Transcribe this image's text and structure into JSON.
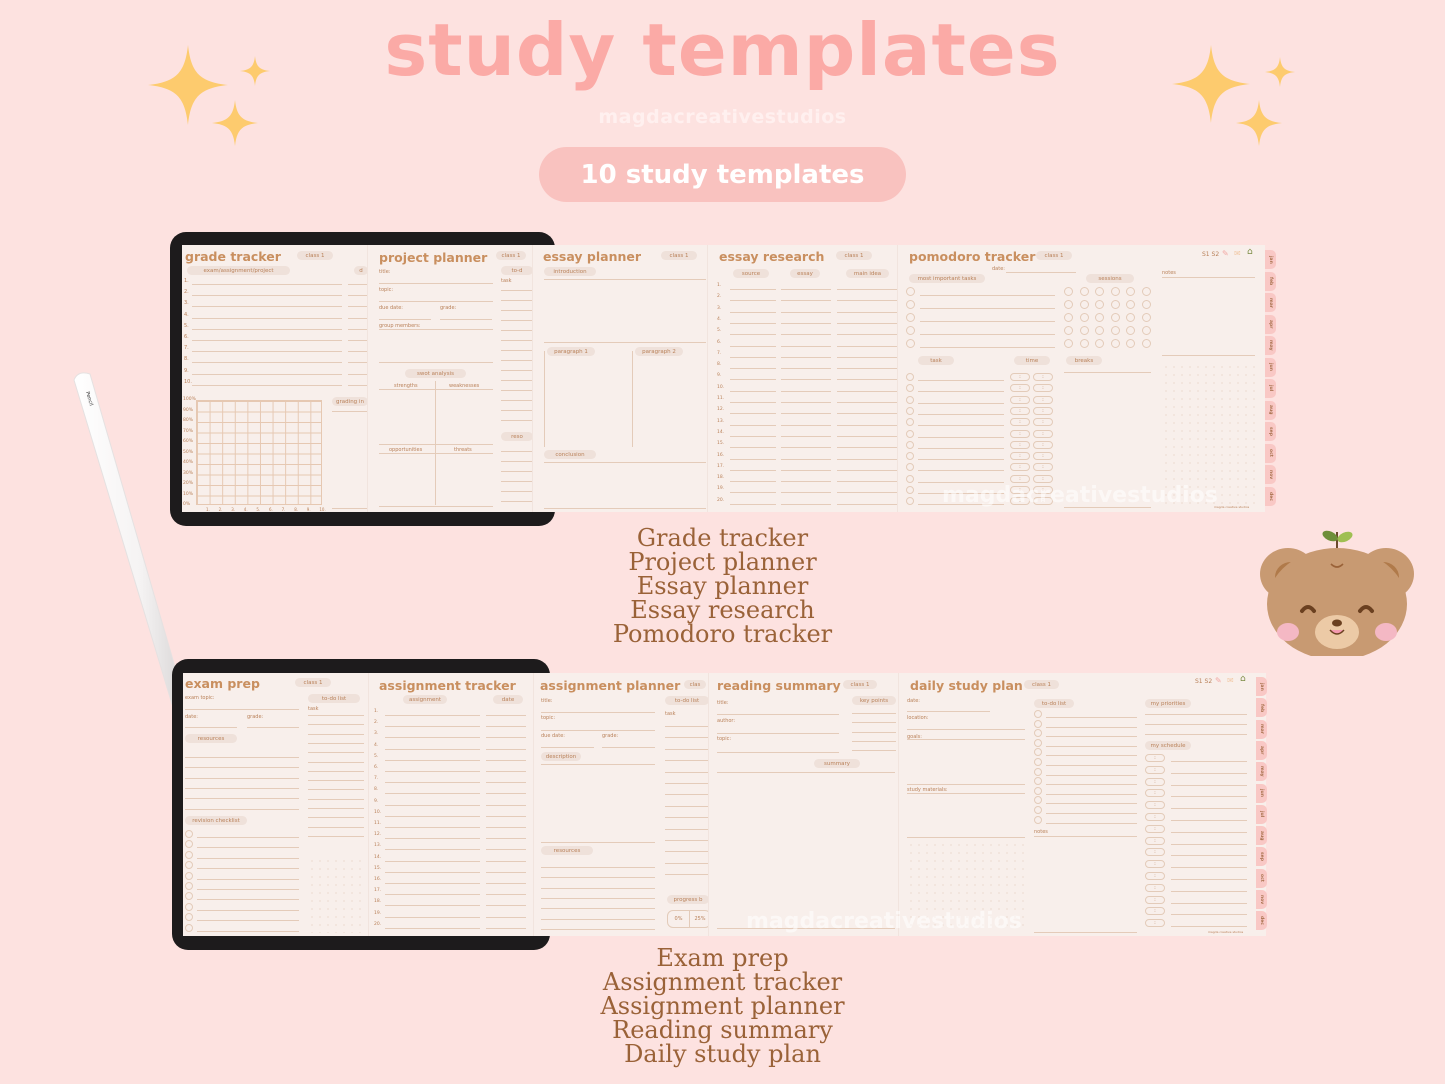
{
  "header": {
    "title": "study templates",
    "brand": "magdacreativestudios",
    "count_pill": "10 study templates"
  },
  "colors": {
    "background": "#fde2e0",
    "title": "#fbaaa6",
    "pill": "#f9c2bf",
    "sparkle": "#fdcb6e",
    "template_text": "#c98f5f",
    "caption": "#9a6238"
  },
  "icons": {
    "sparkles": "sparkle-icon",
    "pencil": "apple-pencil",
    "bear": "bear-mascot",
    "planner_pencil": "pencil-icon",
    "planner_envelope": "envelope-icon",
    "planner_home": "home-icon"
  },
  "pencil_label": "Pencil",
  "top_row": {
    "captions": [
      "Grade tracker",
      "Project planner",
      "Essay planner",
      "Essay research",
      "Pomodoro tracker"
    ],
    "grade_tracker": {
      "title": "grade tracker",
      "class_tag": "class 1",
      "col_header": "exam/assignment/project",
      "col2_header": "d",
      "rows": [
        "1.",
        "2.",
        "3.",
        "4.",
        "5.",
        "6.",
        "7.",
        "8.",
        "9.",
        "10."
      ],
      "chart_y_labels": [
        "100%",
        "90%",
        "80%",
        "70%",
        "60%",
        "50%",
        "40%",
        "30%",
        "20%",
        "10%",
        "0%"
      ],
      "chart_x_labels": [
        "1.",
        "2.",
        "3.",
        "4.",
        "5.",
        "6.",
        "7.",
        "8.",
        "9.",
        "10."
      ],
      "side_tag": "grading in"
    },
    "project_planner": {
      "title": "project planner",
      "class_tag": "class 1",
      "fields": [
        "title:",
        "topic:",
        "due date:",
        "grade:",
        "group members:"
      ],
      "todo_tag": "to-d",
      "todo_task": "task",
      "swot_tag": "swot analysis",
      "swot": [
        "strengths",
        "weaknesses",
        "opportunities",
        "threats"
      ],
      "resources_tag": "reso"
    },
    "essay_planner": {
      "title": "essay planner",
      "class_tag": "class 1",
      "sections": [
        "introduction",
        "paragraph 1",
        "paragraph 2",
        "conclusion"
      ]
    },
    "essay_research": {
      "title": "essay research",
      "class_tag": "class 1",
      "columns": [
        "source",
        "essay",
        "main idea"
      ],
      "rows": [
        "1.",
        "2.",
        "3.",
        "4.",
        "5.",
        "6.",
        "7.",
        "8.",
        "9.",
        "10.",
        "11.",
        "12.",
        "13.",
        "14.",
        "15.",
        "16.",
        "17.",
        "18.",
        "19.",
        "20."
      ]
    },
    "pomodoro_tracker": {
      "title": "pomodoro tracker",
      "class_tag": "class 1",
      "date_label": "date:",
      "mit_tag": "most important tasks",
      "sessions_tag": "sessions",
      "notes_label": "notes",
      "task_tag": "task",
      "time_tag": "time",
      "breaks_tag": "breaks",
      "time_placeholder": ":",
      "semester": "S1 S2",
      "footer": "magda creative studios"
    },
    "months": [
      "jan",
      "feb",
      "mar",
      "apr",
      "may",
      "jun",
      "jul",
      "aug",
      "sep",
      "oct",
      "nov",
      "dec"
    ],
    "watermark": "magdacreativestudios"
  },
  "bottom_row": {
    "captions": [
      "Exam prep",
      "Assignment tracker",
      "Assignment planner",
      "Reading summary",
      "Daily study plan"
    ],
    "exam_prep": {
      "title": "exam prep",
      "class_tag": "class 1",
      "fields": [
        "exam topic:",
        "date:",
        "grade:"
      ],
      "resources_tag": "resources",
      "revision_tag": "revision checklist",
      "todo_tag": "to-do list",
      "todo_task": "task"
    },
    "assignment_tracker": {
      "title": "assignment tracker",
      "columns": [
        "assignment",
        "date"
      ],
      "rows": [
        "1.",
        "2.",
        "3.",
        "4.",
        "5.",
        "6.",
        "7.",
        "8.",
        "9.",
        "10.",
        "11.",
        "12.",
        "13.",
        "14.",
        "15.",
        "16.",
        "17.",
        "18.",
        "19.",
        "20."
      ]
    },
    "assignment_planner": {
      "title": "assignment planner",
      "class_tag": "clas",
      "fields": [
        "title:",
        "topic:",
        "due date:",
        "grade:"
      ],
      "description_tag": "description",
      "resources_tag": "resources",
      "todo_tag": "to-do list",
      "todo_task": "task",
      "progress_tag": "progress b",
      "progress_values": [
        "0%",
        "25%"
      ]
    },
    "reading_summary": {
      "title": "reading summary",
      "class_tag": "class 1",
      "fields": [
        "title:",
        "author:",
        "topic:"
      ],
      "key_points_tag": "key points",
      "summary_tag": "summary"
    },
    "daily_study_plan": {
      "title": "daily study plan",
      "class_tag": "class 1",
      "fields": [
        "date:",
        "location:",
        "goals:",
        "study materials:"
      ],
      "todo_tag": "to-do list",
      "notes_label": "notes",
      "priorities_tag": "my priorities",
      "schedule_tag": "my schedule",
      "time_placeholder": ":",
      "semester": "S1 S2",
      "footer": "magda creative studios"
    },
    "months": [
      "jan",
      "feb",
      "mar",
      "apr",
      "may",
      "jun",
      "jul",
      "aug",
      "sep",
      "oct",
      "nov",
      "dec"
    ],
    "watermark": "magdacreativestudios"
  }
}
